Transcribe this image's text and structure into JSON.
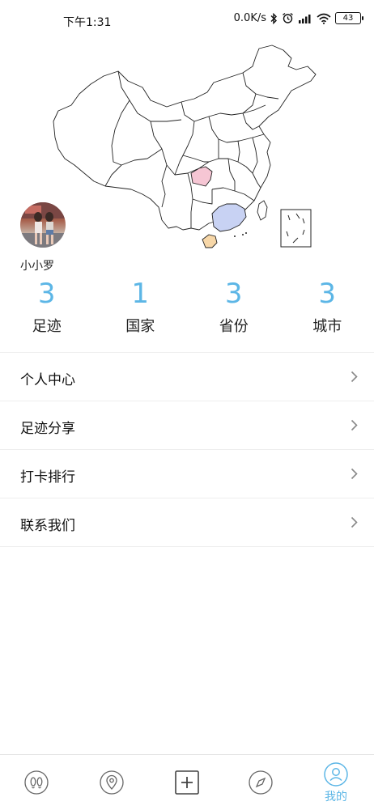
{
  "status_bar": {
    "time": "下午1:31",
    "network_speed": "0.0K/s",
    "battery": "43"
  },
  "profile": {
    "username": "小小罗"
  },
  "stats": [
    {
      "value": "3",
      "label": "足迹"
    },
    {
      "value": "1",
      "label": "国家"
    },
    {
      "value": "3",
      "label": "省份"
    },
    {
      "value": "3",
      "label": "城市"
    }
  ],
  "menu": [
    {
      "label": "个人中心"
    },
    {
      "label": "足迹分享"
    },
    {
      "label": "打卡排行"
    },
    {
      "label": "联系我们"
    }
  ],
  "tabbar": {
    "active_label": "我的"
  },
  "map": {
    "highlighted_regions": [
      {
        "region": "chongqing",
        "color": "#f6c6d4"
      },
      {
        "region": "guangdong",
        "color": "#c8d2f3"
      },
      {
        "region": "hainan",
        "color": "#f7d7a8"
      }
    ]
  },
  "colors": {
    "accent": "#5cb6e6"
  }
}
